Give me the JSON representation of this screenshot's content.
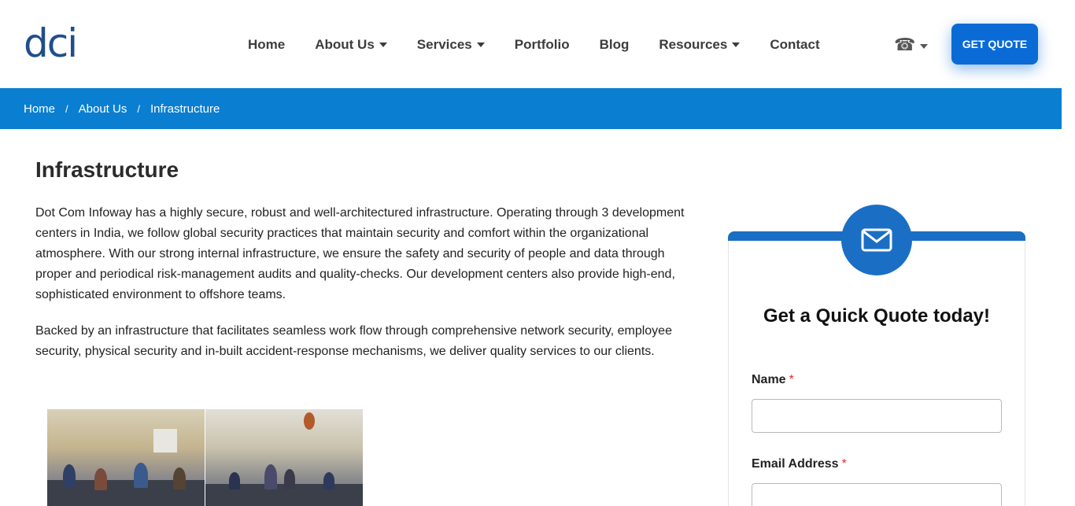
{
  "logo": {
    "text": "dci"
  },
  "nav": {
    "items": [
      {
        "label": "Home",
        "dropdown": false
      },
      {
        "label": "About Us",
        "dropdown": true
      },
      {
        "label": "Services",
        "dropdown": true
      },
      {
        "label": "Portfolio",
        "dropdown": false
      },
      {
        "label": "Blog",
        "dropdown": false
      },
      {
        "label": "Resources",
        "dropdown": true
      },
      {
        "label": "Contact",
        "dropdown": false
      }
    ],
    "phone_icon": "telephone-icon",
    "quote_button": "GET QUOTE"
  },
  "breadcrumb": {
    "items": [
      "Home",
      "About Us",
      "Infrastructure"
    ],
    "separator": "/"
  },
  "main": {
    "title": "Infrastructure",
    "paragraphs": [
      "Dot Com Infoway has a highly secure, robust and well-architectured infrastructure. Operating through 3 development centers in India, we follow global security practices that maintain security and comfort within the organizational atmosphere. With our strong internal infrastructure, we ensure the safety and security of people and data through proper and periodical risk-management audits and quality-checks. Our development centers also provide high-end, sophisticated environment to offshore teams.",
      "Backed by an infrastructure that facilitates seamless work flow through comprehensive network security, employee security, physical security and in-built accident-response mechanisms, we deliver quality services to our clients."
    ]
  },
  "quote_form": {
    "icon": "envelope-icon",
    "title": "Get a Quick Quote today!",
    "fields": [
      {
        "label": "Name",
        "required_mark": "*",
        "value": ""
      },
      {
        "label": "Email Address",
        "required_mark": "*",
        "value": ""
      }
    ]
  },
  "colors": {
    "brand_blue": "#0a7ed1",
    "button_blue": "#0a6bd6",
    "card_blue": "#1a6fc4",
    "required_red": "#d9302c"
  }
}
